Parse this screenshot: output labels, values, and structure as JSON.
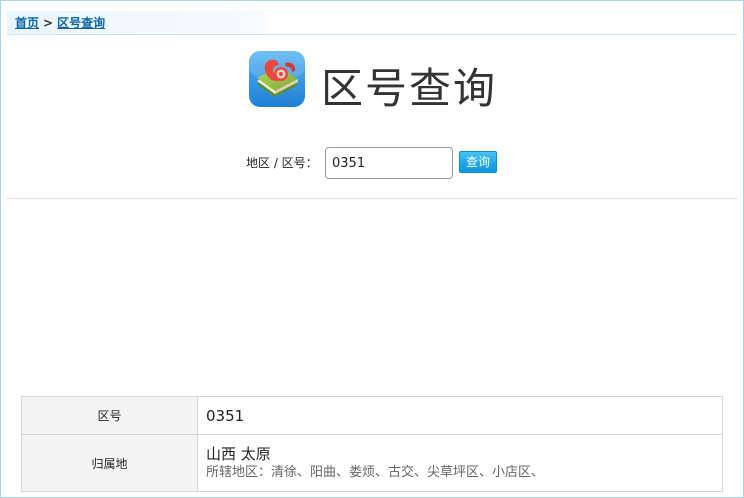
{
  "breadcrumb": {
    "home": "首页",
    "separator": ">",
    "current": "区号查询"
  },
  "header": {
    "icon": "phone-book-icon",
    "title": "区号查询"
  },
  "search": {
    "label": "地区 / 区号：",
    "value": "0351",
    "button": "查询"
  },
  "result": {
    "rows": [
      {
        "label": "区号",
        "value": "0351"
      },
      {
        "label": "归属地",
        "value": "山西 太原",
        "sub": "所辖地区：清徐、阳曲、娄烦、古交、尖草坪区、小店区、"
      }
    ]
  },
  "colors": {
    "border": "#a9d7ef",
    "link": "#0b63a8",
    "button": "#1aa8ea"
  }
}
